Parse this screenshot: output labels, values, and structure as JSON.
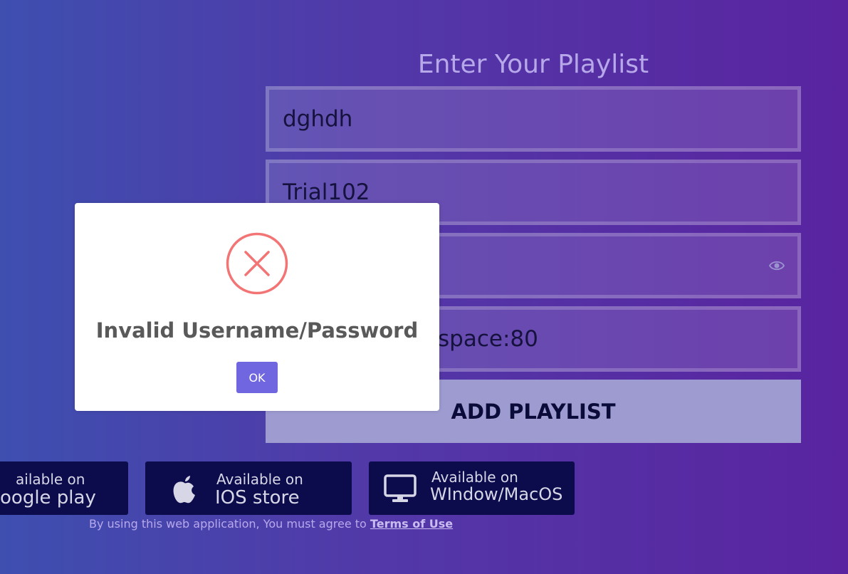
{
  "form": {
    "title": "Enter Your Playlist",
    "fields": [
      {
        "value": "dghdh"
      },
      {
        "value": "Trial102"
      },
      {
        "value": ""
      },
      {
        "value": "space:80"
      }
    ],
    "add_button_label": "ADD PLAYLIST"
  },
  "stores": [
    {
      "small": "ailable on",
      "big": "oogle play",
      "icon": "google-play-icon"
    },
    {
      "small": "Available on",
      "big": "IOS store",
      "icon": "apple-icon"
    },
    {
      "small": "Available on",
      "big": "WIndow/MacOS",
      "icon": "monitor-icon"
    }
  ],
  "terms": {
    "text": "By using this web application, You must agree to ",
    "link": "Terms of Use"
  },
  "dialog": {
    "message": "Invalid Username/Password",
    "ok_label": "OK",
    "icon": "error-x-icon"
  },
  "colors": {
    "accent": "#7066e0",
    "error": "#f27474",
    "store_bg": "#0c0c4d"
  }
}
